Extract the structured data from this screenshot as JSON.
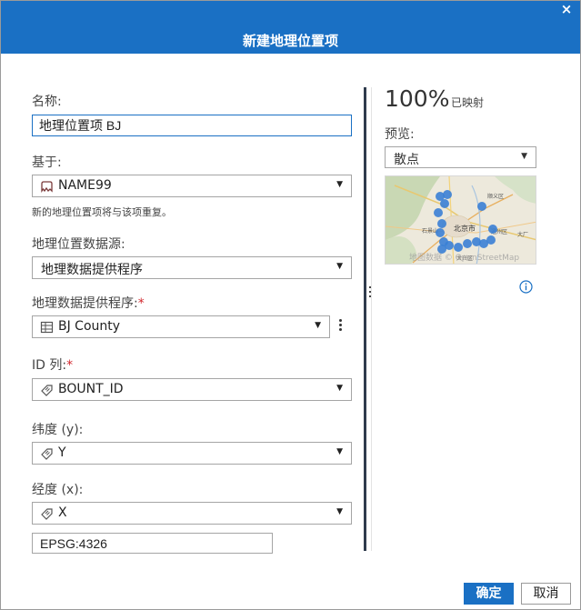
{
  "dialog": {
    "title": "新建地理位置项",
    "close_glyph": "×"
  },
  "form": {
    "name_label": "名称:",
    "name_value": "地理位置项 BJ",
    "based_on_label": "基于:",
    "based_on_value": "NAME99",
    "based_on_icon": "geo-shape-icon",
    "hint": "新的地理位置项将与该项重复。",
    "source_label": "地理位置数据源:",
    "source_value": "地理数据提供程序",
    "provider_label": "地理数据提供程序:",
    "provider_required": "*",
    "provider_value": "BJ County",
    "provider_icon": "table-icon",
    "id_label": "ID 列:",
    "id_required": "*",
    "id_value": "BOUNT_ID",
    "id_icon": "tag-icon",
    "lat_label": "纬度 (y):",
    "lat_value": "Y",
    "lat_icon": "tag-icon",
    "lon_label": "经度 (x):",
    "lon_value": "X",
    "lon_icon": "tag-icon",
    "epsg": "EPSG:4326"
  },
  "preview": {
    "percent": "100%",
    "percent_label": "已映射",
    "label": "预览:",
    "type_value": "散点",
    "map": {
      "place_labels": [
        "顺义区",
        "北京市",
        "通州区",
        "大兴区",
        "石景山",
        "大厂"
      ],
      "watermark": "地图数据 © OpenStreetMap",
      "point_color": "#3a7fd5"
    }
  },
  "buttons": {
    "ok": "确定",
    "cancel": "取消"
  },
  "colors": {
    "accent": "#1a70c4",
    "required": "#d2282e"
  }
}
